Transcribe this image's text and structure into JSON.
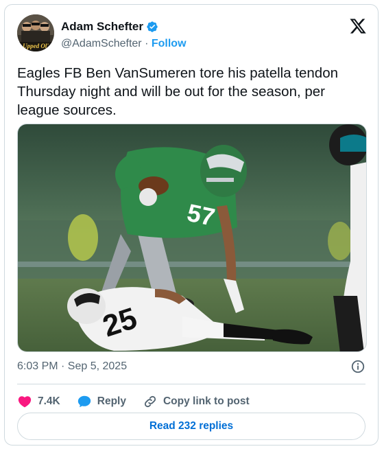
{
  "author": {
    "name": "Adam Schefter",
    "handle": "@AdamSchefter",
    "separator": "·",
    "follow_label": "Follow",
    "avatar_caption": "Upped Ol'"
  },
  "tweet": {
    "text": "Eagles FB Ben VanSumeren tore his patella tendon Thursday night and will be out for the season, per league sources.",
    "timestamp": "6:03 PM · Sep 5, 2025"
  },
  "media": {
    "jersey_number_eagles": "57",
    "jersey_number_jaguars": "25"
  },
  "actions": {
    "likes": "7.4K",
    "reply_label": "Reply",
    "copy_link_label": "Copy link to post"
  },
  "read_replies_label": "Read 232 replies",
  "colors": {
    "accent_blue": "#1d9bf0",
    "link_blue": "#006fd6",
    "like_pink": "#f91880",
    "reply_blue": "#1d9bf0",
    "eagles_green": "#2f8a4a"
  },
  "icons": [
    "verified-badge-icon",
    "x-logo-icon",
    "info-icon",
    "heart-icon",
    "reply-bubble-icon",
    "link-icon"
  ]
}
